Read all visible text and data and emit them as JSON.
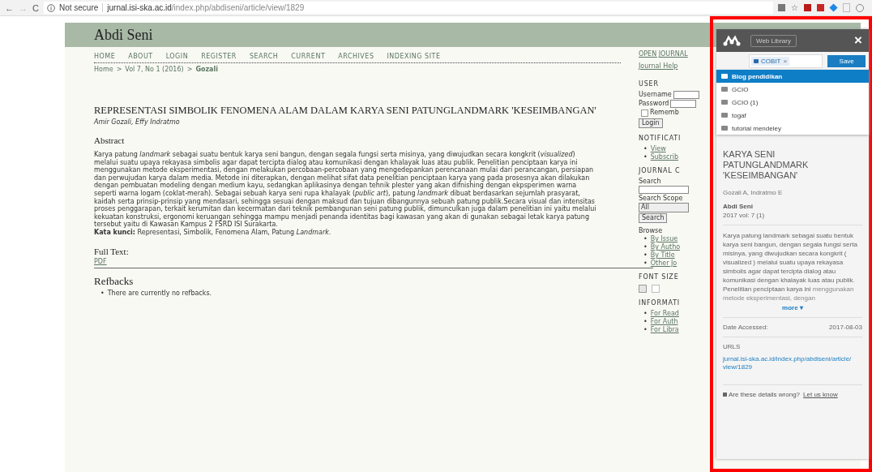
{
  "browser": {
    "back": "←",
    "forward": "→",
    "reload": "C",
    "star": "☆",
    "secure_label": "Not secure",
    "url_host": "jurnal.isi-ska.ac.id",
    "url_path": "/index.php/abdiseni/article/view/1829"
  },
  "site": {
    "title": "Abdi Seni",
    "nav": [
      "HOME",
      "ABOUT",
      "LOGIN",
      "REGISTER",
      "SEARCH",
      "CURRENT",
      "ARCHIVES",
      "INDEXING SITE"
    ],
    "breadcrumb": [
      {
        "label": "Home",
        "current": false
      },
      {
        "label": "Vol 7, No 1 (2016)",
        "current": false
      },
      {
        "label": "Gozali",
        "current": true
      }
    ],
    "breadcrumb_sep": ">",
    "bullet": "•",
    "article": {
      "title": "REPRESENTASI SIMBOLIK FENOMENA ALAM DALAM KARYA SENI PATUNGLANDMARK 'KESEIMBANGAN'",
      "authors": "Amir Gozali, Effy Indratmo",
      "abstract_heading": "Abstract",
      "abstract": "Karya patung *landmark* sebagai suatu bentuk karya seni bangun, dengan segala fungsi serta misinya, yang diwujudkan secara kongkrit (*visualized*) melalui suatu upaya rekayasa simbolis agar dapat tercipta dialog atau komunikasi dengan khalayak luas atau publik. Penelitian penciptaan karya ini menggunakan metode eksperimentasi, dengan melakukan percobaan-percobaan yang mengedepankan perencanaan mulai dari perancangan, persiapan dan perwujudan karya dalam media. Metode ini diterapkan, dengan melihat sifat data penelitian penciptaan karya yang pada prosesnya akan dilakukan dengan pembuatan modeling dengan medium kayu, sedangkan aplikasinya dengan tehnik plester yang akan difnishing dengan ekpsperimen warna seperti warna logam (coklat-merah). Sebagai sebuah karya seni rupa khalayak (*public art*), patung *landmark* dibuat berdasarkan sejumlah prasyarat, kaidah serta prinsip-prinsip yang mendasari, sehingga sesuai dengan maksud dan tujuan dibangunnya sebuah patung publik.Secara visual dan intensitas proses penggarapan, terkait kerumitan dan kecermatan dari teknik pembangunan seni patung publik, dimunculkan juga dalam penelitian ini yaitu melalui kekuatan konstruksi, ergonomi keruangan sehingga mampu menjadi penanda identitas bagi kawasan yang akan di gunakan sebagai letak karya patung tersebut yaitu di Kawasan Kampus 2 FSRD ISI Surakarta.",
      "keywords": "**Kata kunci:** Representasi, Simbolik, Fenomena Alam, Patung *Landmark*.",
      "full_text_heading": "Full Text:",
      "pdf": "PDF",
      "refbacks_heading": "Refbacks",
      "refbacks": [
        "There are currently no refbacks."
      ]
    }
  },
  "sidebar": {
    "open_journal": "OPEN JOURNAL",
    "help": "Journal Help",
    "user_heading": "USER",
    "username_label": "Username",
    "password_label": "Password",
    "remember_label": "Rememb",
    "remember_checked": false,
    "login": "Login",
    "notif_heading": "NOTIFICATI",
    "notif_links": [
      "View",
      "Subscrib"
    ],
    "journal_heading": "JOURNAL C",
    "search_label": "Search",
    "scope_label": "Search Scope",
    "scope_value": "All",
    "search_button": "Search",
    "browse_label": "Browse",
    "browse_links": [
      "By Issue",
      "By Autho",
      "By Title",
      "Other Jo"
    ],
    "font_heading": "FONT SIZE",
    "info_heading": "INFORMATI",
    "info_links": [
      "For Read",
      "For Auth",
      "For Libra"
    ]
  },
  "mendeley": {
    "web_library": "Web Library",
    "close": "×",
    "tag": "COBIT",
    "tag_remove": "×",
    "save": "Save",
    "folders": [
      {
        "name": "Blog pendidikan",
        "selected": true
      },
      {
        "name": "GCIO",
        "selected": false
      },
      {
        "name": "GCIO (1)",
        "selected": false
      },
      {
        "name": "togaf",
        "selected": false
      },
      {
        "name": "tutorial mendeley",
        "selected": false
      }
    ],
    "title": "KARYA SENI PATUNGLANDMARK 'KESEIMBANGAN'",
    "authors": "Gozali A,  Indratmo E",
    "journal": "Abdi Seni",
    "issue": "2017 vol: 7 (1)",
    "abstract": "Karya patung landmark sebagai suatu bentuk karya seni bangun, dengan segala fungsi serta misinya, yang diwujudkan secara kongkrit ( visualized ) melalui suatu upaya rekayasa simbolis agar dapat tercipta dialog atau komunikasi dengan khalayak luas atau publik. Penelitian penciptaan karya ini",
    "abstract_faded": "menggunakan metode eksperimentasi, dengan",
    "more": "more ▾",
    "date_label": "Date Accessed:",
    "date_value": "2017-08-03",
    "urls_label": "URLS",
    "url": "jurnal.isi-ska.ac.id/index.php/abdiseni/article/view/1829",
    "report_text": "Are these details wrong?",
    "report_link": "Let us know"
  }
}
